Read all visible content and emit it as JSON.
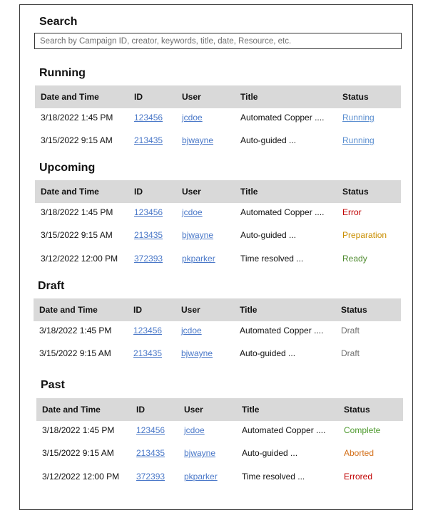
{
  "search": {
    "heading": "Search",
    "placeholder": "Search by Campaign ID, creator, keywords, title, date, Resource, etc."
  },
  "columns": [
    "Date and Time",
    "ID",
    "User",
    "Title",
    "Status"
  ],
  "sections": {
    "running": {
      "heading": "Running",
      "rows": [
        {
          "datetime": "3/18/2022 1:45 PM",
          "id": "123456",
          "user": "jcdoe",
          "title": "Automated Copper ....",
          "status": "Running"
        },
        {
          "datetime": "3/15/2022 9:15 AM",
          "id": "213435",
          "user": "bjwayne",
          "title": "Auto-guided ...",
          "status": "Running"
        }
      ]
    },
    "upcoming": {
      "heading": "Upcoming",
      "rows": [
        {
          "datetime": "3/18/2022 1:45 PM",
          "id": "123456",
          "user": "jcdoe",
          "title": "Automated Copper ....",
          "status": "Error"
        },
        {
          "datetime": "3/15/2022 9:15 AM",
          "id": "213435",
          "user": "bjwayne",
          "title": "Auto-guided ...",
          "status": "Preparation"
        },
        {
          "datetime": "3/12/2022 12:00 PM",
          "id": "372393",
          "user": "pkparker",
          "title": "Time resolved ...",
          "status": "Ready"
        }
      ]
    },
    "draft": {
      "heading": "Draft",
      "rows": [
        {
          "datetime": "3/18/2022 1:45 PM",
          "id": "123456",
          "user": "jcdoe",
          "title": "Automated Copper ....",
          "status": "Draft"
        },
        {
          "datetime": "3/15/2022 9:15 AM",
          "id": "213435",
          "user": "bjwayne",
          "title": "Auto-guided ...",
          "status": "Draft"
        }
      ]
    },
    "past": {
      "heading": "Past",
      "rows": [
        {
          "datetime": "3/18/2022 1:45 PM",
          "id": "123456",
          "user": "jcdoe",
          "title": "Automated Copper ....",
          "status": "Complete"
        },
        {
          "datetime": "3/15/2022 9:15 AM",
          "id": "213435",
          "user": "bjwayne",
          "title": "Auto-guided ...",
          "status": "Aborted"
        },
        {
          "datetime": "3/12/2022 12:00 PM",
          "id": "372393",
          "user": "pkparker",
          "title": "Time resolved ...",
          "status": "Errored"
        }
      ]
    }
  },
  "status_colors": {
    "Running": "#5b8fd0",
    "Error": "#c00000",
    "Preparation": "#c98e00",
    "Ready": "#4e8a2e",
    "Draft": "#6e6e6e",
    "Complete": "#4e9a2e",
    "Aborted": "#d4701a",
    "Errored": "#c00000",
    "link": "#4a78c8",
    "header_bg": "#d9d9d9"
  }
}
